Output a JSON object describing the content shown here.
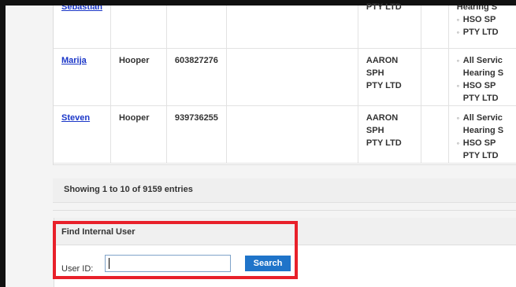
{
  "users": {
    "rows": [
      {
        "first_name": "Sebastian",
        "last_name": "",
        "id": "",
        "org_line1": "PTY LTD",
        "org_line2": "",
        "services": [
          "Hearing S",
          "HSO SP",
          "PTY LTD"
        ]
      },
      {
        "first_name": "Marija",
        "last_name": "Hooper",
        "id": "603827276",
        "org_line1": "AARON SPH",
        "org_line2": "PTY LTD",
        "services": [
          "All Servic",
          "Hearing S",
          "HSO SP",
          "PTY LTD"
        ]
      },
      {
        "first_name": "Steven",
        "last_name": "Hooper",
        "id": "939736255",
        "org_line1": "AARON SPH",
        "org_line2": "PTY LTD",
        "services": [
          "All Servic",
          "Hearing S",
          "HSO SP",
          "PTY LTD"
        ]
      }
    ]
  },
  "pagination": {
    "summary": "Showing 1 to 10 of 9159 entries"
  },
  "find_user": {
    "title": "Find Internal User",
    "label": "User ID:",
    "input_value": "",
    "button_label": "Search"
  },
  "colors": {
    "highlight": "#e8202a",
    "button": "#1f74c9",
    "link": "#1a36c8"
  }
}
